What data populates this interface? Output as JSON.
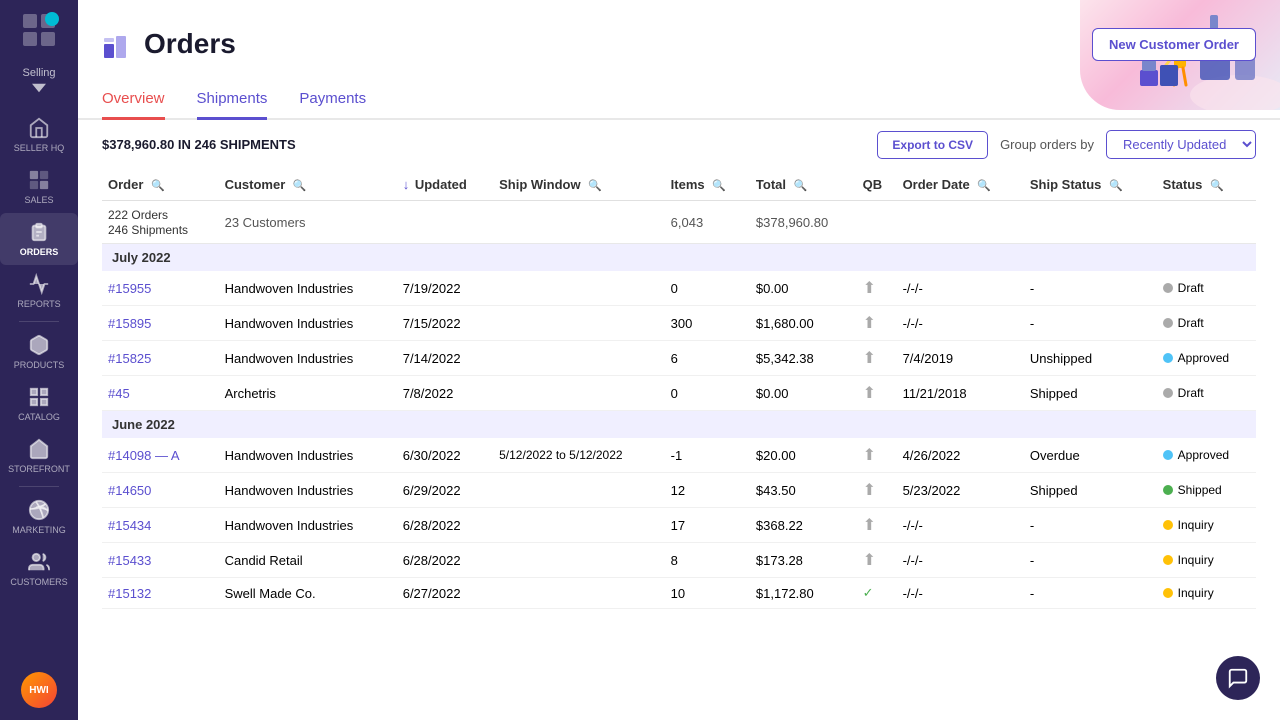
{
  "sidebar": {
    "logo_text": "grid-logo",
    "selling": "Selling",
    "chevron": "▾",
    "items": [
      {
        "id": "seller-hq",
        "label": "SELLER HQ",
        "icon": "hq"
      },
      {
        "id": "sales",
        "label": "SALES",
        "icon": "sales"
      },
      {
        "id": "orders",
        "label": "ORDERS",
        "icon": "orders",
        "active": true
      },
      {
        "id": "reports",
        "label": "REPORTS",
        "icon": "reports"
      },
      {
        "id": "products",
        "label": "PRODUCTS",
        "icon": "products"
      },
      {
        "id": "catalog",
        "label": "CATALOG",
        "icon": "catalog"
      },
      {
        "id": "storefront",
        "label": "STOREFRONT",
        "icon": "storefront"
      },
      {
        "id": "marketing",
        "label": "MARKETING",
        "icon": "marketing"
      },
      {
        "id": "customers",
        "label": "CUSTOMERS",
        "icon": "customers"
      }
    ]
  },
  "header": {
    "title": "Orders",
    "new_order_btn": "New Customer Order"
  },
  "tabs": [
    {
      "id": "overview",
      "label": "Overview",
      "active": true,
      "style": "overview"
    },
    {
      "id": "shipments",
      "label": "Shipments",
      "active": false
    },
    {
      "id": "payments",
      "label": "Payments",
      "active": false
    }
  ],
  "toolbar": {
    "summary": "$378,960.80 IN 246 SHIPMENTS",
    "export_btn": "Export to CSV",
    "group_label": "Group orders by",
    "group_value": "Recently Updated"
  },
  "table": {
    "columns": [
      {
        "id": "order",
        "label": "Order"
      },
      {
        "id": "customer",
        "label": "Customer"
      },
      {
        "id": "updated",
        "label": "Updated",
        "sort": true
      },
      {
        "id": "ship_window",
        "label": "Ship Window"
      },
      {
        "id": "items",
        "label": "Items"
      },
      {
        "id": "total",
        "label": "Total"
      },
      {
        "id": "qb",
        "label": "QB"
      },
      {
        "id": "order_date",
        "label": "Order Date"
      },
      {
        "id": "ship_status",
        "label": "Ship Status"
      },
      {
        "id": "status",
        "label": "Status"
      }
    ],
    "summary_row": {
      "orders": "222 Orders",
      "shipments": "246 Shipments",
      "customers": "23 Customers",
      "items": "6,043",
      "total": "$378,960.80"
    },
    "groups": [
      {
        "label": "July 2022",
        "rows": [
          {
            "order": "#15955",
            "customer": "Handwoven Industries",
            "updated": "7/19/2022",
            "ship_window": "",
            "items": "0",
            "total": "$0.00",
            "qb": "upload",
            "order_date": "-/-/-",
            "ship_status": "-",
            "status": "Draft",
            "status_color": "gray"
          },
          {
            "order": "#15895",
            "customer": "Handwoven Industries",
            "updated": "7/15/2022",
            "ship_window": "",
            "items": "300",
            "total": "$1,680.00",
            "qb": "upload",
            "order_date": "-/-/-",
            "ship_status": "-",
            "status": "Draft",
            "status_color": "gray"
          },
          {
            "order": "#15825",
            "customer": "Handwoven Industries",
            "updated": "7/14/2022",
            "ship_window": "",
            "items": "6",
            "total": "$5,342.38",
            "qb": "upload",
            "order_date": "7/4/2019",
            "ship_status": "Unshipped",
            "status": "Approved",
            "status_color": "blue"
          },
          {
            "order": "#45",
            "customer": "Archetris",
            "updated": "7/8/2022",
            "ship_window": "",
            "items": "0",
            "total": "$0.00",
            "qb": "upload",
            "order_date": "11/21/2018",
            "ship_status": "Shipped",
            "status": "Draft",
            "status_color": "gray"
          }
        ]
      },
      {
        "label": "June 2022",
        "rows": [
          {
            "order": "#14098 — A",
            "customer": "Handwoven Industries",
            "updated": "6/30/2022",
            "ship_window": "5/12/2022 to 5/12/2022",
            "items": "-1",
            "total": "$20.00",
            "qb": "upload",
            "order_date": "4/26/2022",
            "ship_status": "Overdue",
            "status": "Approved",
            "status_color": "blue"
          },
          {
            "order": "#14650",
            "customer": "Handwoven Industries",
            "updated": "6/29/2022",
            "ship_window": "",
            "items": "12",
            "total": "$43.50",
            "qb": "upload",
            "order_date": "5/23/2022",
            "ship_status": "Shipped",
            "status": "Shipped",
            "status_color": "green"
          },
          {
            "order": "#15434",
            "customer": "Handwoven Industries",
            "updated": "6/28/2022",
            "ship_window": "",
            "items": "17",
            "total": "$368.22",
            "qb": "upload",
            "order_date": "-/-/-",
            "ship_status": "-",
            "status": "Inquiry",
            "status_color": "yellow"
          },
          {
            "order": "#15433",
            "customer": "Candid Retail",
            "updated": "6/28/2022",
            "ship_window": "",
            "items": "8",
            "total": "$173.28",
            "qb": "upload",
            "order_date": "-/-/-",
            "ship_status": "-",
            "status": "Inquiry",
            "status_color": "yellow"
          },
          {
            "order": "#15132",
            "customer": "Swell Made Co.",
            "updated": "6/27/2022",
            "ship_window": "",
            "items": "10",
            "total": "$1,172.80",
            "qb": "check",
            "order_date": "-/-/-",
            "ship_status": "-",
            "status": "Inquiry",
            "status_color": "yellow"
          }
        ]
      }
    ]
  }
}
